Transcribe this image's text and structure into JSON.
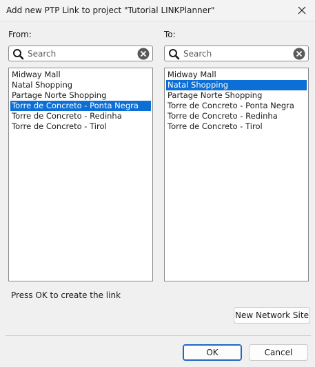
{
  "window": {
    "title": "Add new PTP Link to project \"Tutorial LINKPlanner\""
  },
  "from": {
    "label": "From:",
    "search_placeholder": "Search",
    "search_value": "",
    "items": [
      {
        "label": "Midway Mall",
        "selected": false
      },
      {
        "label": "Natal Shopping",
        "selected": false
      },
      {
        "label": "Partage Norte Shopping",
        "selected": false
      },
      {
        "label": "Torre de Concreto - Ponta Negra",
        "selected": true
      },
      {
        "label": "Torre de Concreto - Redinha",
        "selected": false
      },
      {
        "label": "Torre de Concreto - Tirol",
        "selected": false
      }
    ]
  },
  "to": {
    "label": "To:",
    "search_placeholder": "Search",
    "search_value": "",
    "items": [
      {
        "label": "Midway Mall",
        "selected": false
      },
      {
        "label": "Natal Shopping",
        "selected": true
      },
      {
        "label": "Partage Norte Shopping",
        "selected": false
      },
      {
        "label": "Torre de Concreto - Ponta Negra",
        "selected": false
      },
      {
        "label": "Torre de Concreto - Redinha",
        "selected": false
      },
      {
        "label": "Torre de Concreto - Tirol",
        "selected": false
      }
    ]
  },
  "status_text": "Press OK to create the link",
  "buttons": {
    "new_site": "New Network Site",
    "ok": "OK",
    "cancel": "Cancel"
  },
  "icons": {
    "search": "search-icon",
    "clear": "clear-icon",
    "close": "close-icon"
  },
  "colors": {
    "selection": "#0b6fd6",
    "primary_border": "#1e67c0"
  }
}
